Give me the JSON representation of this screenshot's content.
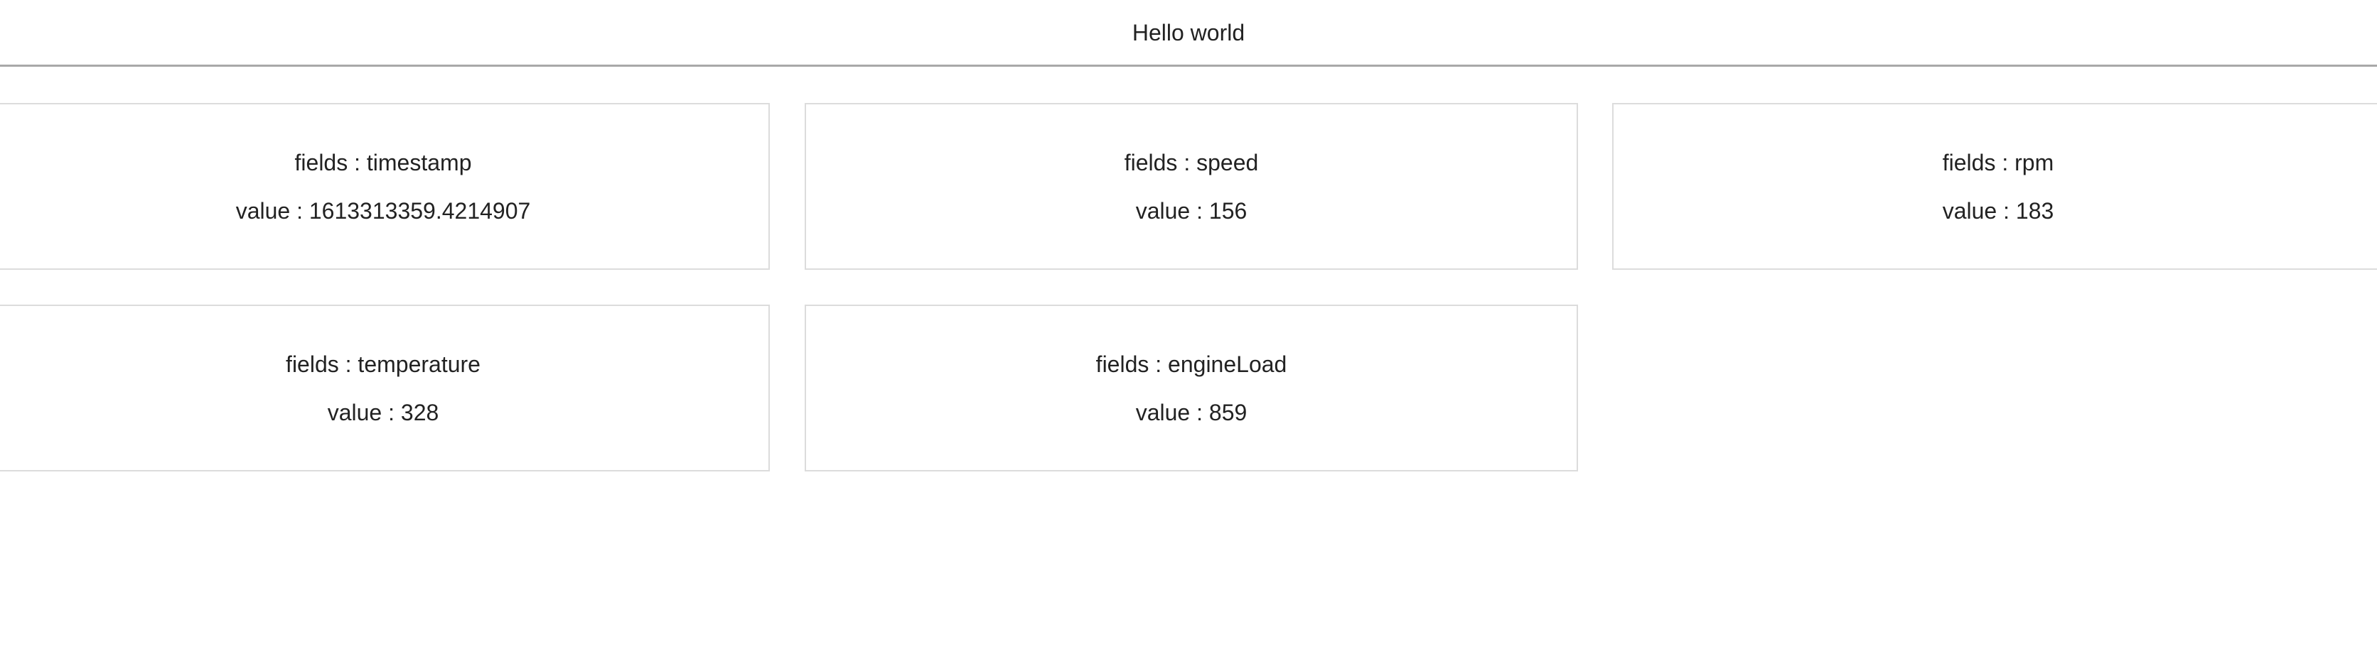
{
  "header": {
    "title": "Hello world"
  },
  "labels": {
    "field_prefix": "fields : ",
    "value_prefix": "value : "
  },
  "cards": [
    {
      "field": "timestamp",
      "value": "1613313359.4214907"
    },
    {
      "field": "speed",
      "value": "156"
    },
    {
      "field": "rpm",
      "value": "183"
    },
    {
      "field": "temperature",
      "value": "328"
    },
    {
      "field": "engineLoad",
      "value": "859"
    }
  ]
}
